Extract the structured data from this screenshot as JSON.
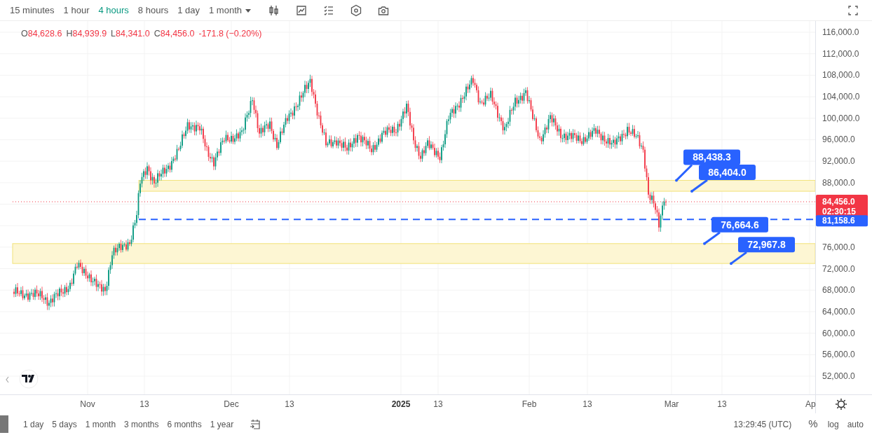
{
  "toolbar": {
    "intervals": [
      {
        "label": "15 minutes",
        "selected": false,
        "dropdown": false
      },
      {
        "label": "1 hour",
        "selected": false,
        "dropdown": false
      },
      {
        "label": "4 hours",
        "selected": true,
        "dropdown": false
      },
      {
        "label": "8 hours",
        "selected": false,
        "dropdown": false
      },
      {
        "label": "1 day",
        "selected": false,
        "dropdown": false
      },
      {
        "label": "1 month",
        "selected": false,
        "dropdown": true
      }
    ]
  },
  "legend": {
    "items": [
      {
        "key": "O",
        "value": "84,628.6"
      },
      {
        "key": "H",
        "value": "84,939.9"
      },
      {
        "key": "L",
        "value": "84,341.0"
      },
      {
        "key": "C",
        "value": "84,456.0"
      }
    ],
    "change": "-171.8 (−0.20%)"
  },
  "price_axis": {
    "ticks": [
      "116,000.0",
      "112,000.0",
      "108,000.0",
      "104,000.0",
      "100,000.0",
      "96,000.0",
      "92,000.0",
      "88,000.0",
      "76,000.0",
      "72,000.0",
      "68,000.0",
      "64,000.0",
      "60,000.0",
      "56,000.0",
      "52,000.0"
    ],
    "last_price": {
      "value": "84,456.0",
      "countdown": "02:30:15"
    },
    "line_tag": "81,158.6"
  },
  "callouts": [
    "88,438.3",
    "86,404.0",
    "76,664.6",
    "72,967.8"
  ],
  "time_axis": [
    {
      "label": "Nov",
      "kind": "month"
    },
    {
      "label": "13",
      "kind": "day"
    },
    {
      "label": "Dec",
      "kind": "month"
    },
    {
      "label": "13",
      "kind": "day"
    },
    {
      "label": "2025",
      "kind": "year"
    },
    {
      "label": "13",
      "kind": "day"
    },
    {
      "label": "Feb",
      "kind": "month"
    },
    {
      "label": "13",
      "kind": "day"
    },
    {
      "label": "Mar",
      "kind": "month"
    },
    {
      "label": "13",
      "kind": "day"
    },
    {
      "label": "Ap",
      "kind": "month"
    }
  ],
  "bottom_bar": {
    "ranges": [
      "1 day",
      "5 days",
      "1 month",
      "3 months",
      "6 months",
      "1 year"
    ],
    "clock": "13:29:45 (UTC)",
    "buttons": [
      "%",
      "log",
      "auto"
    ]
  }
}
